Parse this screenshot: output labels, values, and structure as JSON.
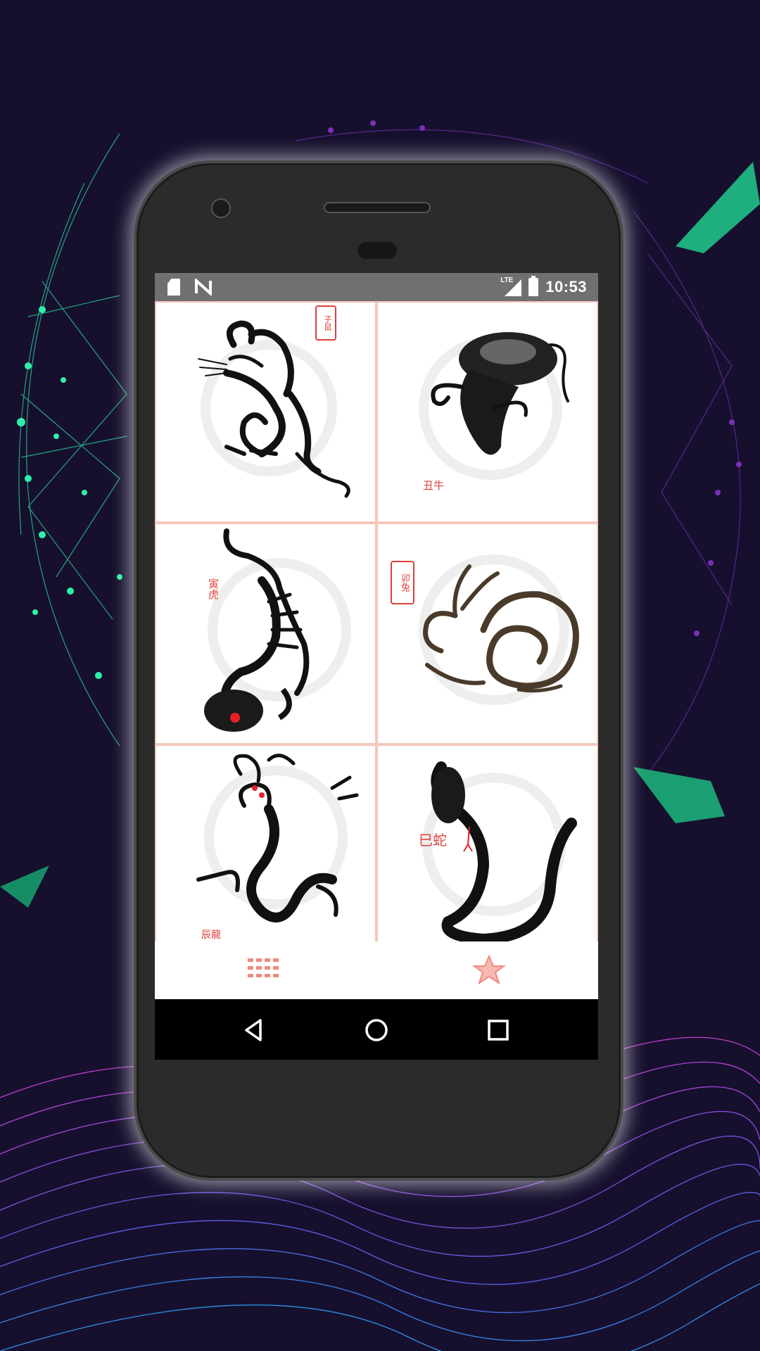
{
  "status_bar": {
    "time": "10:53",
    "network": "LTE"
  },
  "grid": {
    "items": [
      {
        "animal": "rat",
        "seal": "子鼠"
      },
      {
        "animal": "ox",
        "seal": "丑牛"
      },
      {
        "animal": "tiger",
        "seal": "寅虎"
      },
      {
        "animal": "rabbit",
        "seal": "卯兔"
      },
      {
        "animal": "dragon",
        "seal": "辰龍"
      },
      {
        "animal": "snake",
        "seal": "巳蛇"
      }
    ]
  },
  "bottom_tabs": [
    {
      "icon": "grid-seal-icon"
    },
    {
      "icon": "star-icon"
    }
  ],
  "colors": {
    "background": "#16102e",
    "seal_red": "#e0403a",
    "tab_accent": "#f08a80",
    "divider": "#f4c8bd"
  }
}
